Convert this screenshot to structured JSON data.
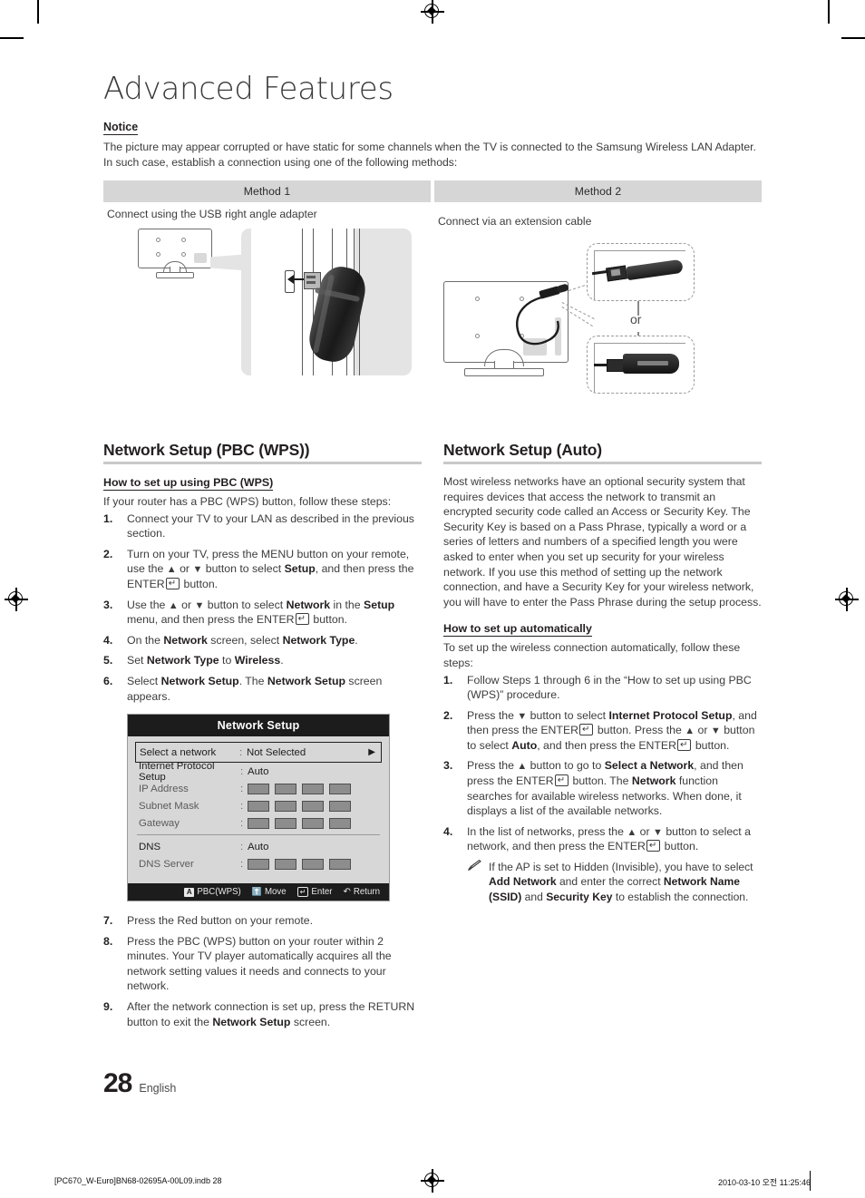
{
  "document": {
    "title": "Advanced Features",
    "page_number": "28",
    "language": "English"
  },
  "notice": {
    "label": "Notice",
    "body": "The picture may appear corrupted or have static for some channels when the TV is connected to the Samsung Wireless LAN Adapter. In such case, establish a connection using one of the following methods:"
  },
  "methods": [
    {
      "header": "Method 1",
      "caption": "Connect using the USB right angle adapter"
    },
    {
      "header": "Method 2",
      "caption": "Connect via an extension cable",
      "or_label": "or"
    }
  ],
  "left_column": {
    "section_title": "Network Setup (PBC (WPS))",
    "subhead": "How to set up using PBC (WPS)",
    "intro": "If your router has a PBC (WPS) button, follow these steps:",
    "steps": [
      {
        "num": "1.",
        "text": "Connect your TV to your LAN as described in the previous section."
      },
      {
        "num": "2.",
        "text": "Turn on your TV, press the MENU button on your remote, use the ▲ or ▼ button to select Setup, and then press the ENTER button."
      },
      {
        "num": "3.",
        "text": "Use the ▲ or ▼ button to select Network in the Setup menu, and then press the ENTER button."
      },
      {
        "num": "4.",
        "text": "On the Network screen, select Network Type."
      },
      {
        "num": "5.",
        "text": "Set Network Type to Wireless."
      },
      {
        "num": "6.",
        "text": "Select Network Setup. The Network Setup screen appears."
      }
    ],
    "steps_after": [
      {
        "num": "7.",
        "text": "Press the Red button on your remote."
      },
      {
        "num": "8.",
        "text": "Press the PBC (WPS) button on your router within 2 minutes. Your TV player automatically acquires all the network setting values it needs and connects to your network."
      },
      {
        "num": "9.",
        "text": "After the network connection is set up, press the RETURN button to exit the Network Setup screen."
      }
    ]
  },
  "osd": {
    "title": "Network Setup",
    "rows": [
      {
        "label": "Select a network",
        "value": "Not Selected",
        "kind": "value",
        "selected": true,
        "caret": "▶"
      },
      {
        "label": "Internet Protocol Setup",
        "value": "Auto",
        "kind": "value",
        "selected": false
      },
      {
        "label": "IP Address",
        "kind": "boxes",
        "selected": false
      },
      {
        "label": "Subnet Mask",
        "kind": "boxes",
        "selected": false
      },
      {
        "label": "Gateway",
        "kind": "boxes",
        "selected": false
      },
      {
        "label": "DNS",
        "value": "Auto",
        "kind": "value",
        "selected": false,
        "above_separator": true
      },
      {
        "label": "DNS Server",
        "kind": "boxes",
        "selected": false
      }
    ],
    "footer": [
      {
        "key": "A",
        "label": "PBC(WPS)",
        "icon": "a-button-badge"
      },
      {
        "key": "↕",
        "label": "Move",
        "icon": "updown-arrow-icon"
      },
      {
        "key": "ENTER",
        "label": "Enter",
        "icon": "enter-key-icon"
      },
      {
        "key": "↺",
        "label": "Return",
        "icon": "return-arrow-icon"
      }
    ]
  },
  "right_column": {
    "section_title": "Network Setup (Auto)",
    "intro": "Most wireless networks have an optional security system that requires devices that access the network to transmit an encrypted security code called an Access or Security Key. The Security Key is based on a Pass Phrase, typically a word or a series of letters and numbers of a specified length you were asked to enter when you set up security for your wireless network.  If you use this method of setting up the network connection, and have a Security Key for your wireless network, you will have to enter the Pass Phrase during the setup process.",
    "subhead": "How to set up automatically",
    "lead": "To set up the wireless connection automatically, follow these steps:",
    "steps": [
      {
        "num": "1.",
        "text": "Follow Steps 1 through 6 in the “How to set up using PBC (WPS)” procedure."
      },
      {
        "num": "2.",
        "text": "Press the ▼ button to select Internet Protocol Setup, and then press the ENTER button. Press the ▲ or ▼ button to select Auto, and then press the ENTER button."
      },
      {
        "num": "3.",
        "text": "Press the ▲ button to go to Select a Network, and then press the ENTER button. The Network function searches for available wireless networks. When done, it displays a list of the available networks."
      },
      {
        "num": "4.",
        "text": "In the list of networks, press the ▲ or ▼ button to select a network, and then press the ENTER button."
      }
    ],
    "note": "If the AP is set to Hidden (Invisible), you have to select Add Network and enter the correct Network Name (SSID) and Security Key to establish the connection."
  },
  "print_footer": {
    "left": "[PC670_W-Euro]BN68-02695A-00L09.indb   28",
    "right": "2010-03-10   오전 11:25:46"
  },
  "colors": {
    "text": "#3c3c3c",
    "heading": "#231f20",
    "rule": "#c9c9c9",
    "table_header_bg": "#d6d6d6",
    "osd_title_bg": "#1c1c1c",
    "osd_body_bg": "#d7d7d7"
  }
}
